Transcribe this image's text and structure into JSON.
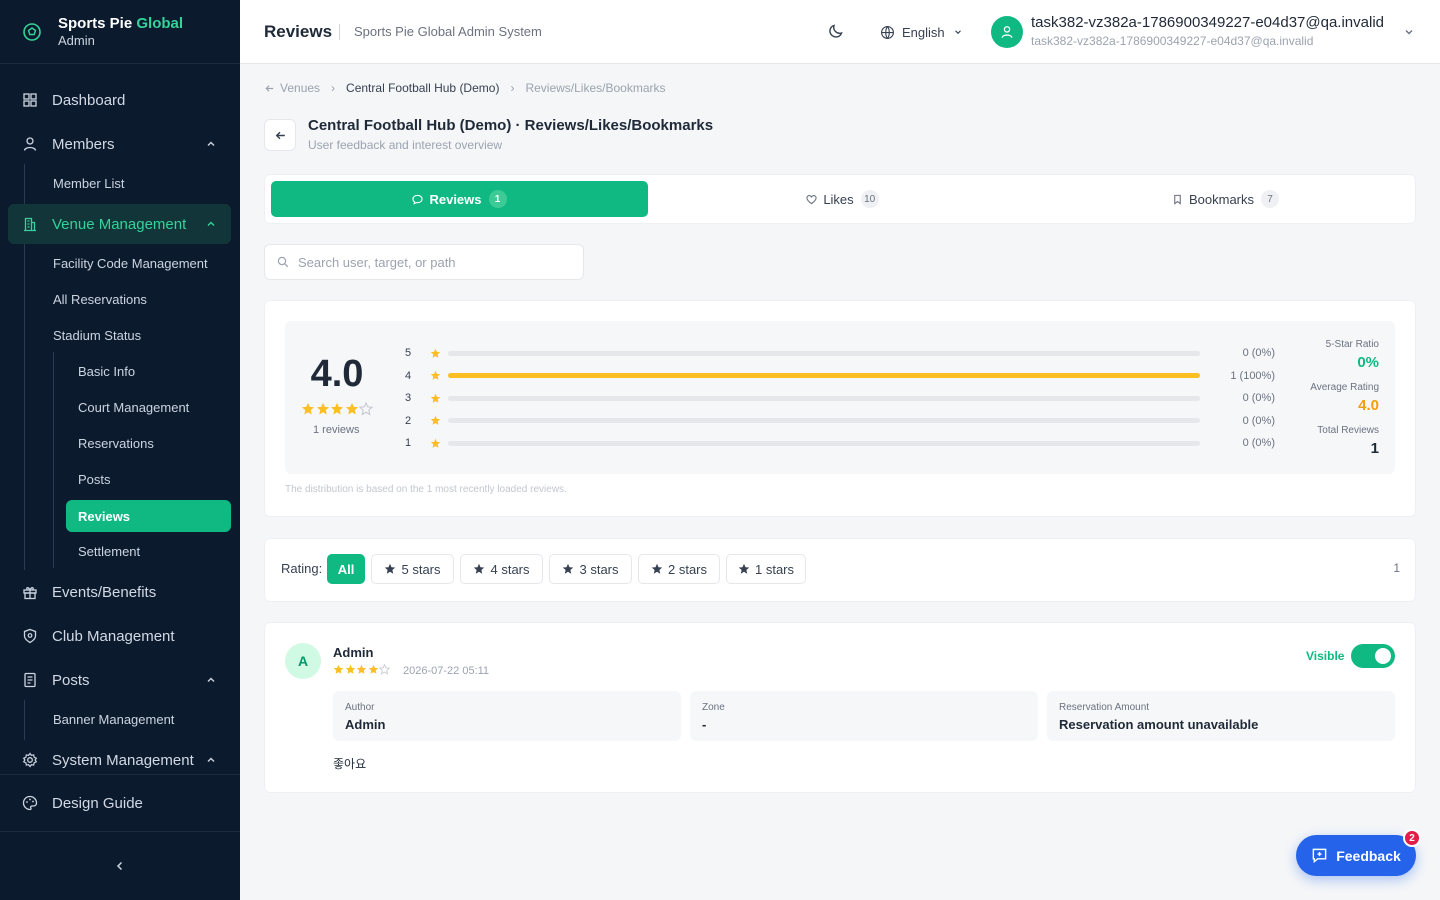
{
  "brand": {
    "name_main": "Sports Pie",
    "name_accent": "Global",
    "subtitle": "Admin"
  },
  "sidebar": {
    "items": [
      {
        "label": "Dashboard",
        "icon": "dashboard-icon"
      },
      {
        "label": "Members",
        "icon": "user-icon",
        "children": [
          {
            "label": "Member List"
          }
        ]
      },
      {
        "label": "Venue Management",
        "icon": "building-icon",
        "active": true,
        "children": [
          {
            "label": "Facility Code Management"
          },
          {
            "label": "All Reservations"
          },
          {
            "label": "Stadium Status",
            "children": [
              {
                "label": "Basic Info"
              },
              {
                "label": "Court Management"
              },
              {
                "label": "Reservations"
              },
              {
                "label": "Posts"
              },
              {
                "label": "Reviews",
                "active": true
              },
              {
                "label": "Settlement"
              }
            ]
          }
        ]
      },
      {
        "label": "Events/Benefits",
        "icon": "gift-icon"
      },
      {
        "label": "Club Management",
        "icon": "shield-icon"
      },
      {
        "label": "Posts",
        "icon": "document-icon",
        "children": [
          {
            "label": "Banner Management"
          }
        ]
      },
      {
        "label": "System Management",
        "icon": "gear-icon"
      }
    ],
    "bottom": {
      "label": "Design Guide",
      "icon": "palette-icon"
    }
  },
  "header": {
    "title": "Reviews",
    "system_name": "Sports Pie Global Admin System",
    "language": "English",
    "user_name": "task382-vz382a-1786900349227-e04d37@qa.invalid",
    "user_email": "task382-vz382a-1786900349227-e04d37@qa.invalid"
  },
  "breadcrumb": {
    "items": [
      "Venues",
      "Central Football Hub (Demo)",
      "Reviews/Likes/Bookmarks"
    ]
  },
  "page": {
    "title": "Central Football Hub (Demo) · Reviews/Likes/Bookmarks",
    "subtitle": "User feedback and interest overview"
  },
  "tabs": [
    {
      "label": "Reviews",
      "count": "1",
      "icon": "chat-icon",
      "active": true
    },
    {
      "label": "Likes",
      "count": "10",
      "icon": "heart-icon"
    },
    {
      "label": "Bookmarks",
      "count": "7",
      "icon": "bookmark-icon"
    }
  ],
  "search": {
    "placeholder": "Search user, target, or path",
    "value": ""
  },
  "summary": {
    "average": "4.0",
    "average_stars": 4,
    "reviews_label": "1 reviews",
    "distribution": [
      {
        "star": "5",
        "fraction": 0,
        "label": "0 (0%)"
      },
      {
        "star": "4",
        "fraction": 1,
        "label": "1 (100%)"
      },
      {
        "star": "3",
        "fraction": 0,
        "label": "0 (0%)"
      },
      {
        "star": "2",
        "fraction": 0,
        "label": "0 (0%)"
      },
      {
        "star": "1",
        "fraction": 0,
        "label": "0 (0%)"
      }
    ],
    "stats": [
      {
        "label": "5-Star Ratio",
        "value": "0%",
        "color": "#10b981"
      },
      {
        "label": "Average Rating",
        "value": "4.0",
        "color": "#f59e0b"
      },
      {
        "label": "Total Reviews",
        "value": "1",
        "color": "#1f2937"
      }
    ],
    "note": "The distribution is based on the 1 most recently loaded reviews."
  },
  "filter": {
    "label": "Rating:",
    "options": [
      "All",
      "5 stars",
      "4 stars",
      "3 stars",
      "2 stars",
      "1 stars"
    ],
    "selected": "All",
    "count": "1"
  },
  "review": {
    "avatar_letter": "A",
    "author": "Admin",
    "stars": 4,
    "date": "2026-07-22 05:11",
    "visible_label": "Visible",
    "visible": true,
    "fields": [
      {
        "key": "Author",
        "value": "Admin"
      },
      {
        "key": "Zone",
        "value": "-"
      },
      {
        "key": "Reservation Amount",
        "value": "Reservation amount unavailable"
      }
    ],
    "content": "좋아요"
  },
  "feedback": {
    "label": "Feedback",
    "badge": "2"
  },
  "colors": {
    "accent": "#10b981",
    "sidebar_bg": "#0c1a2e",
    "star": "#fbbf24",
    "feedback": "#2563eb"
  }
}
